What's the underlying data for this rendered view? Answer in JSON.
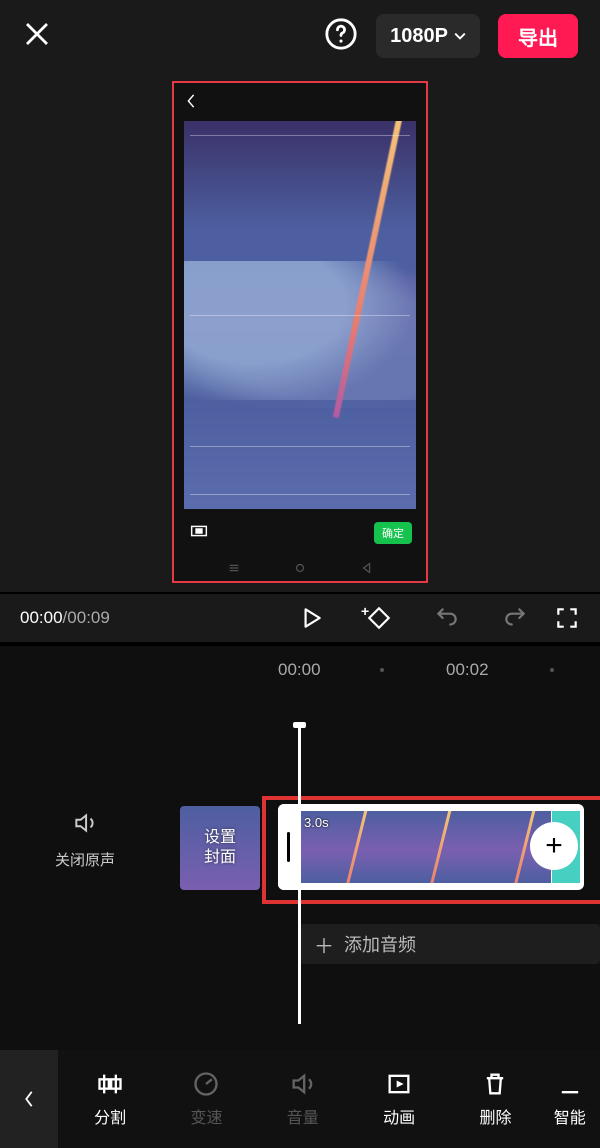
{
  "topbar": {
    "resolution": "1080P",
    "export": "导出"
  },
  "preview": {
    "confirm": "确定"
  },
  "transport": {
    "current": "00:00",
    "total": "00:09"
  },
  "ruler": {
    "t0": "00:00",
    "t1": "00:02"
  },
  "tracks": {
    "mute": "关闭原声",
    "cover_l1": "设置",
    "cover_l2": "封面",
    "clip_duration": "3.0s",
    "add_audio": "添加音频"
  },
  "toolbar": {
    "split": "分割",
    "speed": "变速",
    "volume": "音量",
    "animate": "动画",
    "delete": "删除",
    "smart": "智能"
  }
}
